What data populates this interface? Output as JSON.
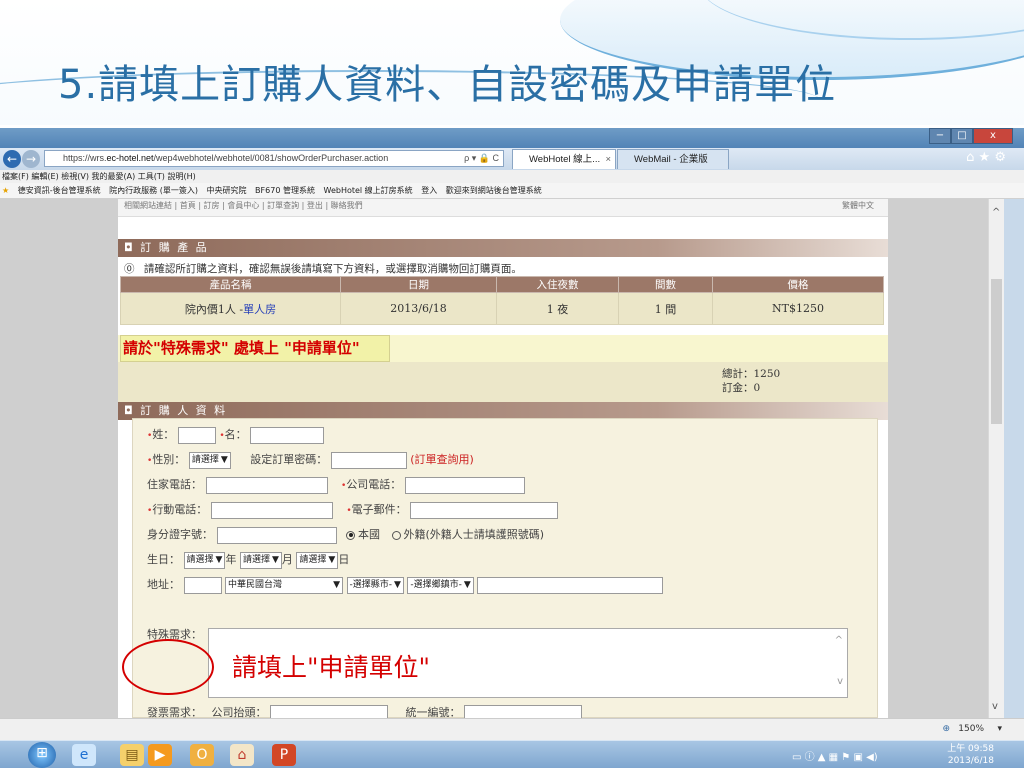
{
  "slide": {
    "title": "5.請填上訂購人資料、自設密碼及申請單位"
  },
  "browser": {
    "url_prefix": "https://wrs.",
    "url_domain": "ec-hotel.net",
    "url_path": "/wep4webhotel/webhotel/0081/showOrderPurchaser.action",
    "url_controls": "ρ ▾ 🔒 C",
    "tabs": [
      "WebHotel 線上...",
      "WebMail - 企業版"
    ],
    "tab_close": "×",
    "window_controls": [
      "−",
      "□",
      "x"
    ],
    "toolbar_icons": "⌂ ★ ⚙",
    "back": "←",
    "forward": "→",
    "menu": [
      "檔案(F)",
      "編輯(E)",
      "檢視(V)",
      "我的最愛(A)",
      "工具(T)",
      "說明(H)"
    ],
    "favorites": [
      "德安資訊-後台管理系統",
      "院內行政服務 (單一簽入)",
      "中央研究院",
      "BF670 管理系統",
      "WebHotel 線上訂房系統",
      "登入",
      "歡迎來到網站後台管理系統"
    ],
    "zoom": "150%",
    "zoom_arrow": "▾"
  },
  "page": {
    "top_strip": "相關網站連結 | 首頁 | 訂房 | 會員中心 | 訂單查詢 | 登出 | 聯絡我們",
    "top_strip_right": "繁體中文",
    "section_products": "◘ 訂 購 產 品",
    "notice_icon": "⓪",
    "notice": "請確認所訂購之資料，確認無誤後請填寫下方資料，或選擇取消購物回訂購頁面。",
    "table_headers": [
      "產品名稱",
      "日期",
      "入住夜數",
      "間數",
      "價格"
    ],
    "order_row": {
      "name_prefix": "院內價1人 -",
      "room": "單人房",
      "date": "2013/6/18",
      "nights": "1 夜",
      "rooms": "1 間",
      "price": "NT$1250"
    },
    "callout": "請於\"特殊需求\" 處填上 \"申請單位\"",
    "total": "總計：1250",
    "deposit": "訂金：0",
    "section_buyer": "◘ 訂 購 人 資 料",
    "form": {
      "required_mark": "•",
      "last_name": "姓：",
      "first_name": "名：",
      "gender": "性別：",
      "gender_value": "請選擇",
      "password": "設定訂單密碼：",
      "password_hint": "(訂單查詢用)",
      "home_phone": "住家電話：",
      "office_phone": "公司電話：",
      "mobile": "行動電話：",
      "email": "電子郵件：",
      "id_no": "身分證字號：",
      "citizen_local": "本國",
      "citizen_foreign": "外籍(外籍人士請填護照號碼)",
      "birthday": "生日：",
      "select_default": "請選擇",
      "year": "年",
      "month": "月",
      "day": "日",
      "address": "地址：",
      "country": "中華民國台灣",
      "county": "-選擇縣市-",
      "town": "-選擇鄉鎮市-",
      "special": "特殊需求：",
      "special_note": "請填上\"申請單位\"",
      "invoice": "發票需求：",
      "invoice_title": "公司抬頭：",
      "invoice_no": "統一編號："
    }
  },
  "taskbar": {
    "time": "上午 09:58",
    "date": "2013/6/18",
    "tray": "▭ ⓘ ▲ ▦ ⚑ ▣ ◀)"
  },
  "colors": {
    "slide_title": "#2a6fa5",
    "section_header": "#9c7868",
    "accent_red": "#d40000",
    "order_row_bg": "#ebe6c8"
  }
}
